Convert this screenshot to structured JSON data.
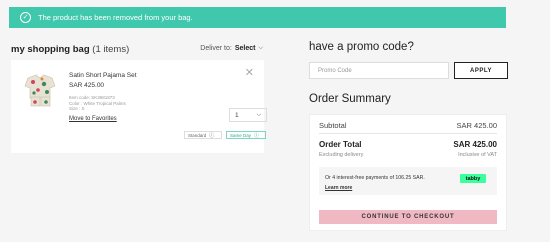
{
  "toast": {
    "message": "The product has been removed from your bag."
  },
  "bag": {
    "title": "my shopping bag",
    "count": "(1 items)",
    "deliver_label": "Deliver to:",
    "deliver_value": "Select"
  },
  "item": {
    "name": "Satin Short Pajama Set",
    "price": "SAR  425.00",
    "meta_code": "Item code: SK3681873",
    "meta_color": "Color : White Tropical Palms",
    "meta_size": "Size : S",
    "qty": "1",
    "favorites_link": "Move to Favorites",
    "ship_standard": "Standard",
    "ship_same_day": "Same Day"
  },
  "promo": {
    "title": "have a promo code?",
    "placeholder": "Promo Code",
    "apply_label": "APPLY"
  },
  "summary": {
    "title": "Order Summary",
    "subtotal_label": "Subtotal",
    "subtotal_value": "SAR 425.00",
    "total_label": "Order Total",
    "total_value": "SAR 425.00",
    "excluding_label": "Excluding delivery",
    "vat_label": "Inclusive of VAT",
    "tabby_text": "Or 4 interest-free payments of 106.25 SAR.",
    "tabby_learn": "Learn more",
    "tabby_logo": "tabby",
    "checkout_label": "CONTINUE TO CHECKOUT"
  },
  "colors": {
    "toast_bg": "#40c8ad",
    "checkout_bg": "#f0b8c2",
    "tabby_green": "#3bff9d"
  }
}
